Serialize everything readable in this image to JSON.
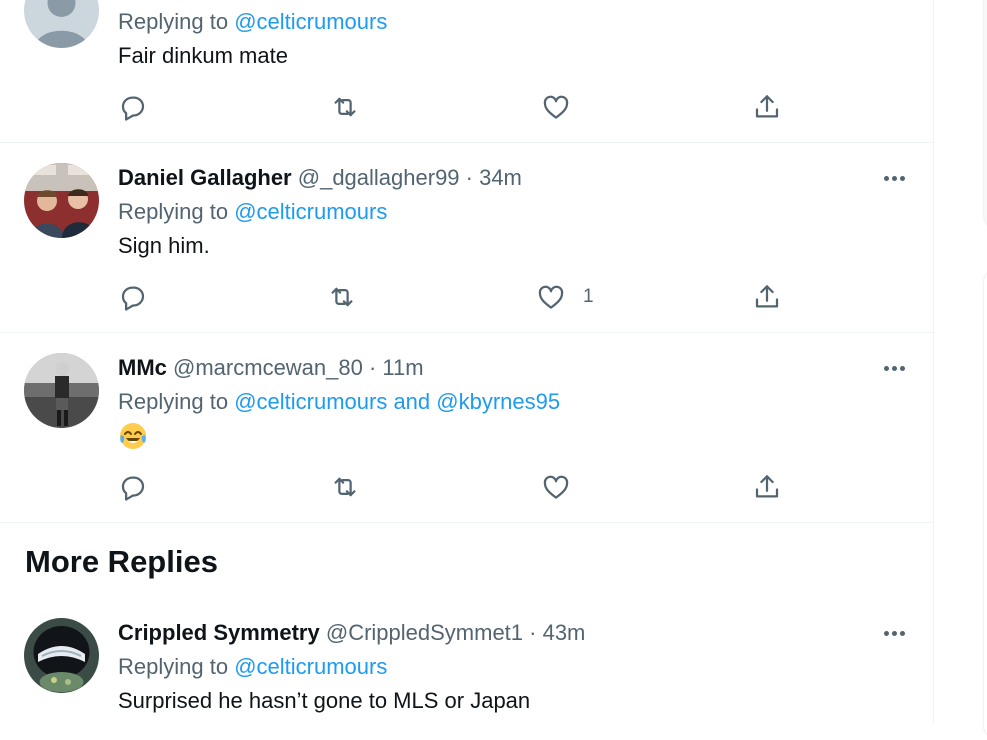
{
  "tweets": [
    {
      "replying_prefix": "Replying to ",
      "replying_to": "@celticrumours",
      "text": "Fair dinkum mate",
      "like_count": ""
    },
    {
      "name": "Daniel Gallagher",
      "meta": "@_dgallagher99 · 34m",
      "replying_prefix": "Replying to ",
      "replying_to": "@celticrumours",
      "text": "Sign him.",
      "like_count": "1"
    },
    {
      "name": "MMc",
      "meta": "@marcmcewan_80 · 11m",
      "replying_prefix": "Replying to ",
      "replying_to": "@celticrumours and @kbyrnes95",
      "emoji": "face-with-tears-of-joy",
      "like_count": ""
    }
  ],
  "more_replies_title": "More Replies",
  "more_replies": [
    {
      "name": "Crippled Symmetry",
      "meta": "@CrippledSymmet1 · 43m",
      "replying_prefix": "Replying to ",
      "replying_to": "@celticrumours",
      "text": "Surprised he hasn’t gone to MLS or Japan"
    }
  ],
  "icons": {
    "reply": "reply-icon",
    "retweet": "retweet-icon",
    "like": "like-icon",
    "share": "share-icon",
    "more": "more-icon"
  },
  "colors": {
    "link": "#1d9bf0",
    "text": "#0f1419",
    "muted": "#536471",
    "divider": "#eff3f4"
  }
}
